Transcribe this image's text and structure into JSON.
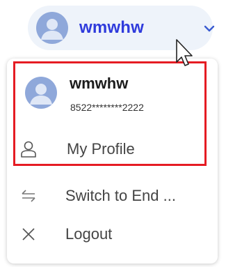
{
  "header": {
    "username": "wmwhw"
  },
  "menu": {
    "user": {
      "name": "wmwhw",
      "account": "8522********2222"
    },
    "items": [
      {
        "label": "My Profile",
        "icon": "user-outline-icon"
      },
      {
        "label": "Switch to End ...",
        "icon": "switch-arrows-icon"
      },
      {
        "label": "Logout",
        "icon": "close-icon"
      }
    ]
  },
  "colors": {
    "username_accent": "#2f3bdc",
    "pill_background": "#eef3fa",
    "avatar": "#8fa8da",
    "highlight": "#e51c23"
  }
}
